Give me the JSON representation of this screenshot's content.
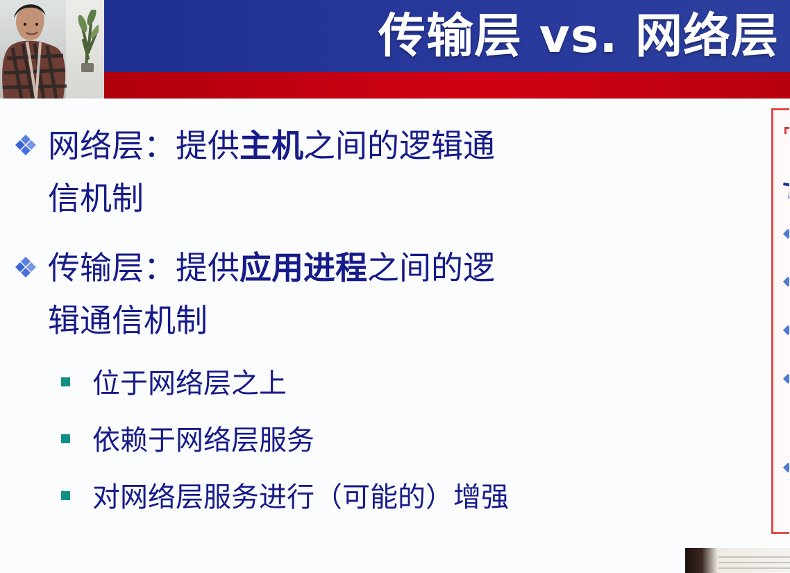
{
  "slide": {
    "title": "传输层 vs. 网络层",
    "bullets": [
      {
        "prefix": "网络层：提供",
        "emphasis": "主机",
        "suffix_line1": "之间的逻辑通",
        "line2": "信机制"
      },
      {
        "prefix": "传输层：提供",
        "emphasis": "应用进程",
        "suffix_line1": "之间的逻",
        "line2": "辑通信机制"
      }
    ],
    "sub_items": [
      "位于网络层之上",
      "依赖于网络层服务",
      "对网络层服务进行（可能的）增强"
    ]
  },
  "colors": {
    "header_blue": "#27379a",
    "header_red": "#c70012",
    "body_text": "#171b89",
    "bullet_diamond": "#5d7fe0",
    "sub_bullet": "#0f8f86",
    "panel_border": "#e04b4b"
  },
  "icons": {
    "main_bullet": "diamond-cluster-icon",
    "sub_bullet": "square-bullet-icon"
  }
}
